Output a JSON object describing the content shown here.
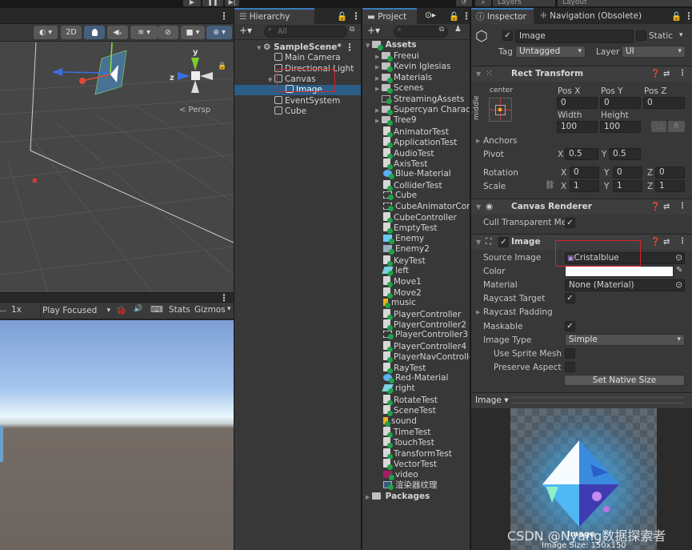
{
  "toolbar": {
    "play_icon": "▶",
    "pause_icon": "❚❚",
    "step_icon": "▶|",
    "layers_label": "Layers",
    "layout_label": "Layout"
  },
  "scene": {
    "toolbar": {
      "shading_icon": "◐",
      "mode_2d": "2D",
      "light_icon": "💡",
      "audio_icon": "🔇",
      "effects_icon": "≋",
      "hidden_icon": "👁",
      "camera_icon": "■",
      "gizmo_icon": "⊕"
    },
    "axis_y": "y",
    "axis_z": "z",
    "persp_label": "< Persp"
  },
  "game": {
    "scale_label": "1x",
    "play_mode": "Play Focused",
    "bug_icon": "🐞",
    "audio_icon": "🔊",
    "keyboard_icon": "⌨",
    "stats_label": "Stats",
    "gizmos_label": "Gizmos"
  },
  "hierarchy": {
    "tab_label": "Hierarchy",
    "search_placeholder": "All",
    "add_label": "+▾",
    "items": [
      {
        "label": "SampleScene*",
        "depth": 0,
        "expanded": true,
        "selected": false
      },
      {
        "label": "Main Camera",
        "depth": 1,
        "selected": false
      },
      {
        "label": "Directional Light",
        "depth": 1,
        "selected": false
      },
      {
        "label": "Canvas",
        "depth": 1,
        "expanded": true,
        "selected": false
      },
      {
        "label": "Image",
        "depth": 2,
        "selected": true
      },
      {
        "label": "EventSystem",
        "depth": 1,
        "selected": false
      },
      {
        "label": "Cube",
        "depth": 1,
        "selected": false
      }
    ]
  },
  "project": {
    "tab_label": "Project",
    "add_label": "+▾",
    "search_placeholder": "",
    "root_label": "Assets",
    "items": [
      {
        "label": "Freeui",
        "type": "folder",
        "expandable": true
      },
      {
        "label": "Kevin Iglesias",
        "type": "folder",
        "expandable": true
      },
      {
        "label": "Materials",
        "type": "folder",
        "expandable": true
      },
      {
        "label": "Scenes",
        "type": "folder",
        "expandable": true
      },
      {
        "label": "StreamingAssets",
        "type": "folder-empty",
        "expandable": false
      },
      {
        "label": "Supercyan Charac",
        "type": "folder",
        "expandable": true
      },
      {
        "label": "Tree9",
        "type": "folder",
        "expandable": true
      },
      {
        "label": "AnimatorTest",
        "type": "script"
      },
      {
        "label": "ApplicationTest",
        "type": "script"
      },
      {
        "label": "AudioTest",
        "type": "script"
      },
      {
        "label": "AxisTest",
        "type": "script"
      },
      {
        "label": "Blue-Material",
        "type": "material"
      },
      {
        "label": "ColliderTest",
        "type": "script"
      },
      {
        "label": "Cube",
        "type": "animator"
      },
      {
        "label": "CubeAnimatorCont",
        "type": "animator"
      },
      {
        "label": "CubeController",
        "type": "script"
      },
      {
        "label": "EmptyTest",
        "type": "script"
      },
      {
        "label": "Enemy",
        "type": "prefab"
      },
      {
        "label": "Enemy2",
        "type": "prefab-variant"
      },
      {
        "label": "KeyTest",
        "type": "script"
      },
      {
        "label": "left",
        "type": "anim"
      },
      {
        "label": "Move1",
        "type": "script"
      },
      {
        "label": "Move2",
        "type": "script"
      },
      {
        "label": "music",
        "type": "audio"
      },
      {
        "label": "PlayerController",
        "type": "script"
      },
      {
        "label": "PlayerController2",
        "type": "script"
      },
      {
        "label": "PlayerController3",
        "type": "animator"
      },
      {
        "label": "PlayerController4",
        "type": "script"
      },
      {
        "label": "PlayerNavControlle",
        "type": "script"
      },
      {
        "label": "RayTest",
        "type": "script"
      },
      {
        "label": "Red-Material",
        "type": "material"
      },
      {
        "label": "right",
        "type": "anim"
      },
      {
        "label": "RotateTest",
        "type": "script"
      },
      {
        "label": "SceneTest",
        "type": "script"
      },
      {
        "label": "sound",
        "type": "audio"
      },
      {
        "label": "TimeTest",
        "type": "script"
      },
      {
        "label": "TouchTest",
        "type": "script"
      },
      {
        "label": "TransformTest",
        "type": "script"
      },
      {
        "label": "VectorTest",
        "type": "script"
      },
      {
        "label": "video",
        "type": "video"
      },
      {
        "label": "渲染器纹理",
        "type": "render-texture"
      }
    ],
    "packages_label": "Packages"
  },
  "inspector": {
    "tab_label": "Inspector",
    "nav_tab_label": "Navigation (Obsolete)",
    "object_name": "Image",
    "active": true,
    "static_label": "Static",
    "static_checked": false,
    "tag_label": "Tag",
    "tag_value": "Untagged",
    "layer_label": "Layer",
    "layer_value": "UI",
    "rect_transform": {
      "title": "Rect Transform",
      "anchor_h": "center",
      "anchor_v": "middle",
      "pos_x_label": "Pos X",
      "pos_x": "0",
      "pos_y_label": "Pos Y",
      "pos_y": "0",
      "pos_z_label": "Pos Z",
      "pos_z": "0",
      "width_label": "Width",
      "width": "100",
      "height_label": "Height",
      "height": "100",
      "r_label": "R",
      "anchors_label": "Anchors",
      "pivot_label": "Pivot",
      "pivot_x": "0.5",
      "pivot_y": "0.5",
      "rotation_label": "Rotation",
      "rot_x": "0",
      "rot_y": "0",
      "rot_z": "0",
      "scale_label": "Scale",
      "scale_x": "1",
      "scale_y": "1",
      "scale_z": "1",
      "x": "X",
      "y": "Y",
      "z": "Z"
    },
    "canvas_renderer": {
      "title": "Canvas Renderer",
      "cull_label": "Cull Transparent Me",
      "cull_checked": true
    },
    "image": {
      "title": "Image",
      "enabled": true,
      "source_image_label": "Source Image",
      "source_image_value": "Cristalblue",
      "color_label": "Color",
      "color_value": "#ffffff",
      "material_label": "Material",
      "material_value": "None (Material)",
      "raycast_target_label": "Raycast Target",
      "raycast_target": true,
      "raycast_padding_label": "Raycast Padding",
      "maskable_label": "Maskable",
      "maskable": true,
      "image_type_label": "Image Type",
      "image_type_value": "Simple",
      "use_sprite_mesh_label": "Use Sprite Mesh",
      "use_sprite_mesh": false,
      "preserve_aspect_label": "Preserve Aspect",
      "preserve_aspect": false,
      "set_native_size_label": "Set Native Size"
    },
    "preview": {
      "dropdown_label": "Image ▾",
      "caption": "Image",
      "size_caption": "Image Size: 150x150"
    }
  },
  "watermark": "CSDN @Nyang数据探索者",
  "colors": {
    "selection": "#2c5d87",
    "accent_tab": "#3a79bb",
    "highlight_box": "#d4262b"
  }
}
